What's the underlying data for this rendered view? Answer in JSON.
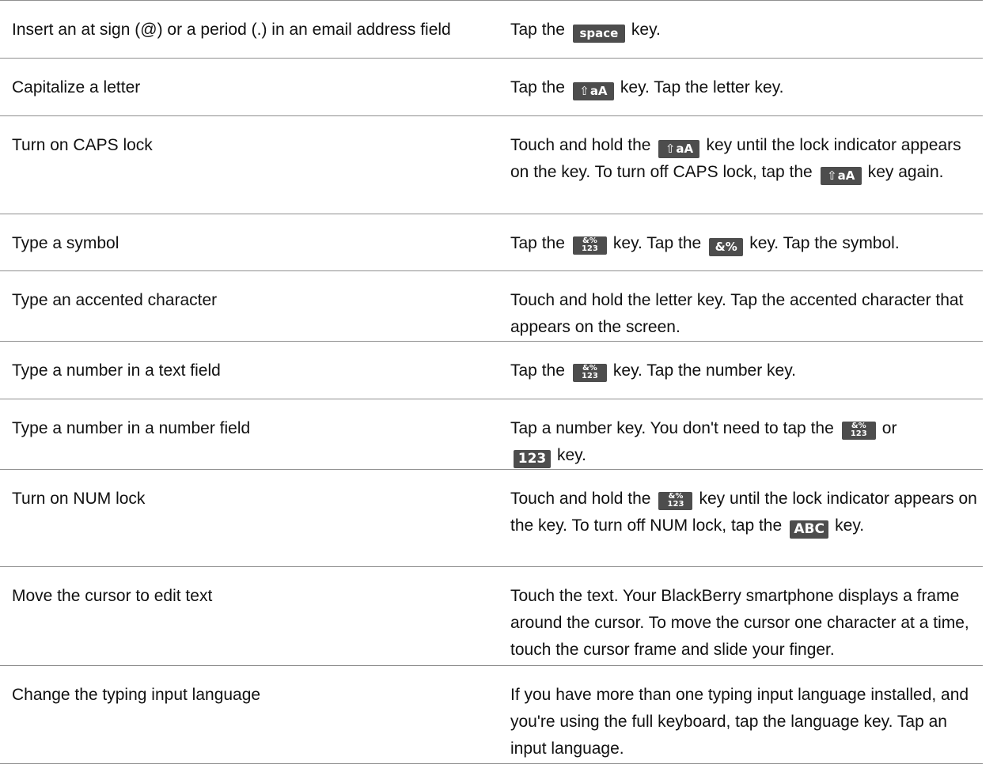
{
  "rows": [
    {
      "task": "Insert an at sign (@) or a period (.) in an email address field",
      "desc": {
        "t1": "Tap the",
        "key1": "space",
        "t2": "key."
      }
    },
    {
      "task": "Capitalize a letter",
      "desc": {
        "t1": "Tap the",
        "key1": "aA",
        "key1_glyph": "⇧",
        "t2": "key. Tap the letter key."
      }
    },
    {
      "task": "Turn on CAPS lock",
      "desc": {
        "t1": "Touch and hold the",
        "key1": "aA",
        "key1_glyph": "⇧",
        "t2": "key until the lock indicator appears on the key. To turn off CAPS lock, tap the",
        "key2": "aA",
        "key2_glyph": "⇧",
        "t3": "key again."
      }
    },
    {
      "task": "Type a symbol",
      "desc": {
        "t1": "Tap the",
        "key1_top": "&%",
        "key1_bottom": "123",
        "t2": "key. Tap the",
        "key2": "&%",
        "t3": "key. Tap the symbol."
      }
    },
    {
      "task": "Type an accented character",
      "desc": {
        "t1": "Touch and hold the letter key. Tap the accented character that appears on the screen."
      }
    },
    {
      "task": "Type a number in a text field",
      "desc": {
        "t1": "Tap the",
        "key1_top": "&%",
        "key1_bottom": "123",
        "t2": "key. Tap the number key."
      }
    },
    {
      "task": "Type a number in a number field",
      "desc": {
        "t1": "Tap a number key. You don't need to tap the",
        "key1_top": "&%",
        "key1_bottom": "123",
        "t2": "or",
        "key2": "123",
        "t3": "key."
      }
    },
    {
      "task": "Turn on NUM lock",
      "desc": {
        "t1": "Touch and hold the",
        "key1_top": "&%",
        "key1_bottom": "123",
        "t2": "key until the lock indicator appears on the key. To turn off NUM lock, tap the",
        "key2": "ABC",
        "t3": "key."
      }
    },
    {
      "task": "Move the cursor to edit text",
      "desc": {
        "t1": "Touch the text. Your BlackBerry smartphone displays a frame around the cursor. To move the cursor one character at a time, touch the cursor frame and slide your finger."
      }
    },
    {
      "task": "Change the typing input language",
      "desc": {
        "t1": "If you have more than one typing input language installed, and you're using the full keyboard, tap the language key. Tap an input language."
      }
    }
  ],
  "colors": {
    "text": "#111111",
    "rule": "#8f8f8f",
    "key_bg": "#4d4d4d",
    "key_text": "#ffffff"
  }
}
